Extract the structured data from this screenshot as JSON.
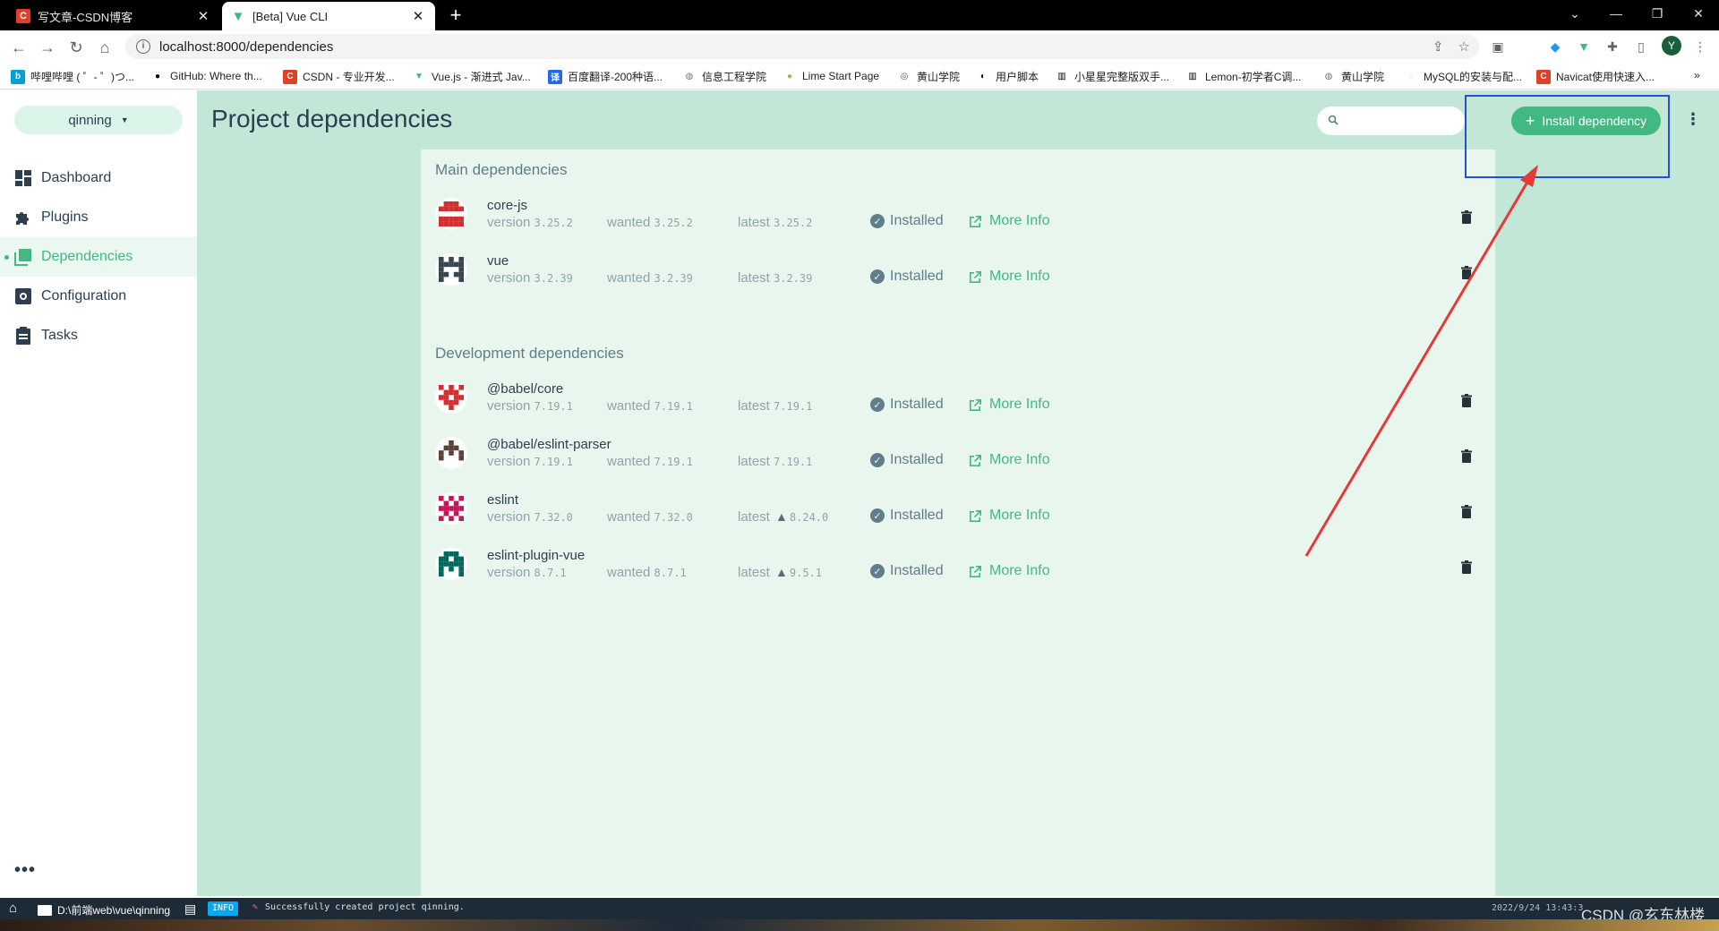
{
  "browser": {
    "tabs": [
      {
        "label": "写文章-CSDN博客",
        "icon": "csdn-icon"
      },
      {
        "label": "[Beta] Vue CLI",
        "icon": "vue-icon"
      }
    ],
    "url": "localhost:8000/dependencies",
    "avatar_letter": "Y",
    "bookmarks": [
      "哔哩哔哩 ( ゜- ゜)つ...",
      "GitHub: Where th...",
      "CSDN - 专业开发...",
      "Vue.js - 渐进式 Jav...",
      "百度翻译-200种语...",
      "信息工程学院",
      "Lime Start Page",
      "黄山学院",
      "用户脚本",
      "小星星完整版双手...",
      "Lemon-初学者C调...",
      "黄山学院",
      "MySQL的安装与配...",
      "Navicat使用快速入..."
    ]
  },
  "sidebar": {
    "project": "qinning",
    "items": [
      {
        "label": "Dashboard",
        "icon": "dashboard-icon"
      },
      {
        "label": "Plugins",
        "icon": "puzzle-icon"
      },
      {
        "label": "Dependencies",
        "icon": "collection-icon",
        "active": true
      },
      {
        "label": "Configuration",
        "icon": "settings-icon"
      },
      {
        "label": "Tasks",
        "icon": "clipboard-icon"
      }
    ]
  },
  "header": {
    "title": "Project dependencies",
    "search_placeholder": "",
    "install_label": "Install dependency"
  },
  "sections": {
    "main": "Main dependencies",
    "dev": "Development dependencies"
  },
  "labels": {
    "version": "version",
    "wanted": "wanted",
    "latest": "latest",
    "installed": "Installed",
    "more_info": "More Info"
  },
  "dependencies": {
    "main": [
      {
        "name": "core-js",
        "version": "3.25.2",
        "wanted": "3.25.2",
        "latest": "3.25.2",
        "outdated": false,
        "color": "#d32f2f"
      },
      {
        "name": "vue",
        "version": "3.2.39",
        "wanted": "3.2.39",
        "latest": "3.2.39",
        "outdated": false,
        "color": "#37474f"
      }
    ],
    "dev": [
      {
        "name": "@babel/core",
        "version": "7.19.1",
        "wanted": "7.19.1",
        "latest": "7.19.1",
        "outdated": false,
        "color": "#d32f2f"
      },
      {
        "name": "@babel/eslint-parser",
        "version": "7.19.1",
        "wanted": "7.19.1",
        "latest": "7.19.1",
        "outdated": false,
        "color": "#5d4037"
      },
      {
        "name": "eslint",
        "version": "7.32.0",
        "wanted": "7.32.0",
        "latest": "8.24.0",
        "outdated": true,
        "color": "#c2185b"
      },
      {
        "name": "eslint-plugin-vue",
        "version": "8.7.1",
        "wanted": "8.7.1",
        "latest": "9.5.1",
        "outdated": true,
        "color": "#00695c"
      }
    ]
  },
  "statusbar": {
    "path": "D:\\前端web\\vue\\qinning",
    "badge": "INFO",
    "message": "Successfully created project qinning.",
    "time": "2022/9/24 13:43:3"
  },
  "watermark": "CSDN @玄东林楼",
  "colors": {
    "accent": "#42b983",
    "background": "#c2e7d6",
    "panel": "#e8f6ee",
    "annotation_box": "#2a4bd7",
    "annotation_arrow": "#e53935"
  }
}
